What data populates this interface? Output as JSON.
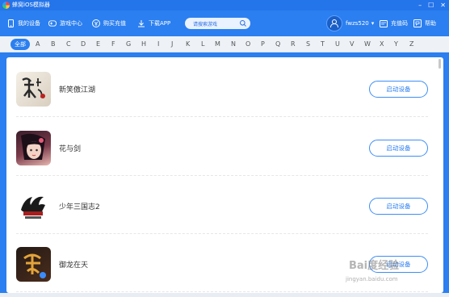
{
  "window": {
    "title": "蜂窝iOS模拟器",
    "controls": [
      "–",
      "☐",
      "✕"
    ]
  },
  "nav": {
    "items": [
      {
        "label": "我的设备",
        "icon": "phone-icon"
      },
      {
        "label": "游戏中心",
        "icon": "gamepad-icon"
      },
      {
        "label": "购买充值",
        "icon": "purchase-icon"
      },
      {
        "label": "下载APP",
        "icon": "download-icon"
      }
    ],
    "search_placeholder": "请搜索游戏",
    "username": "fwzs520",
    "recharge": "充值码",
    "help": "帮助"
  },
  "alpha": {
    "all": "全部",
    "letters": [
      "A",
      "B",
      "C",
      "D",
      "E",
      "F",
      "G",
      "H",
      "I",
      "J",
      "K",
      "L",
      "M",
      "N",
      "O",
      "P",
      "Q",
      "R",
      "S",
      "T",
      "U",
      "V",
      "W",
      "X",
      "Y",
      "Z"
    ]
  },
  "games": [
    {
      "name": "新笑傲江湖",
      "button": "启动设备",
      "icon": "xiaoao-jianghu-game-icon"
    },
    {
      "name": "花与剑",
      "button": "启动设备",
      "icon": "hua-yu-jian-game-icon"
    },
    {
      "name": "少年三国志2",
      "button": "启动设备",
      "icon": "shaonian-sanguozhi-game-icon"
    },
    {
      "name": "御龙在天",
      "button": "启动设备",
      "icon": "yulong-zaitian-game-icon"
    }
  ],
  "watermark": {
    "brand": "Bai度经验",
    "url": "jingyan.baidu.com"
  },
  "colors": {
    "accent": "#2b7ff0",
    "titlebar": "#2474ea",
    "panel": "#ffffff"
  }
}
